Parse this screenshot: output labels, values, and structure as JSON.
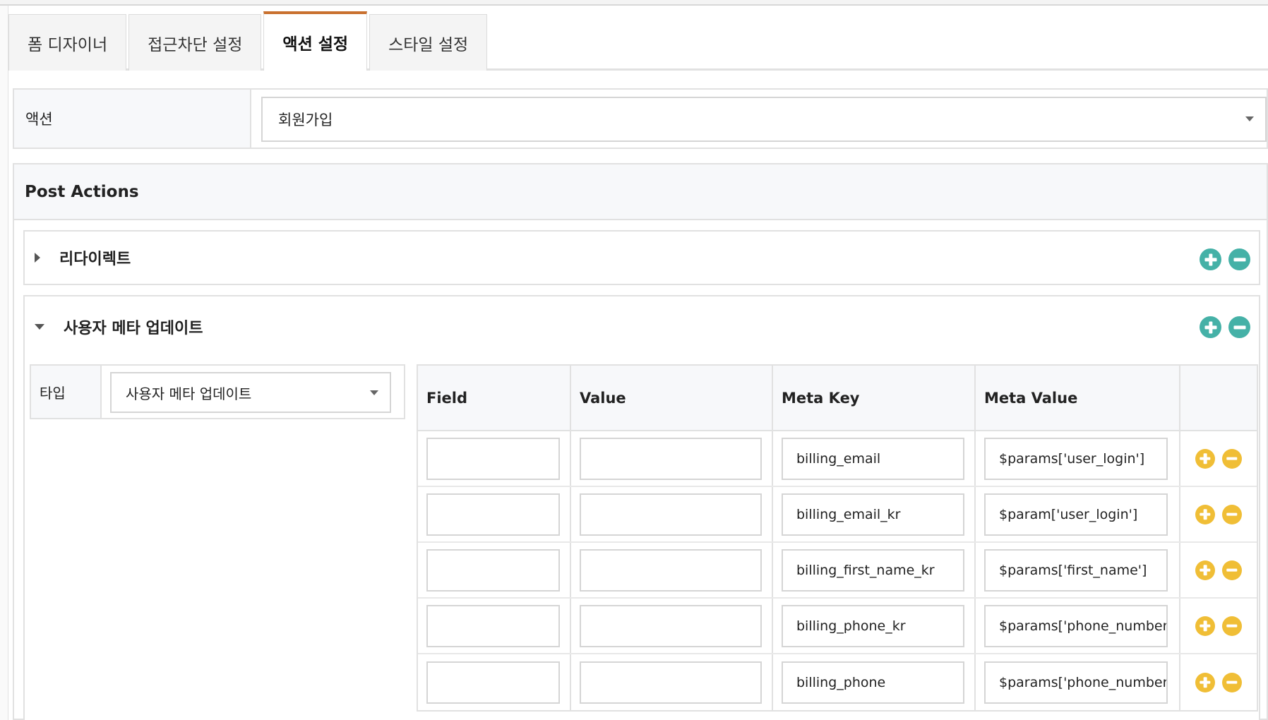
{
  "tabs": [
    {
      "label": "폼 디자이너",
      "active": false
    },
    {
      "label": "접근차단 설정",
      "active": false
    },
    {
      "label": "액션 설정",
      "active": true
    },
    {
      "label": "스타일 설정",
      "active": false
    }
  ],
  "action": {
    "label": "액션",
    "selected": "회원가입"
  },
  "post_actions": {
    "title": "Post Actions",
    "items": [
      {
        "title": "리다이렉트",
        "expanded": false
      },
      {
        "title": "사용자 메타 업데이트",
        "expanded": true
      }
    ]
  },
  "meta_update": {
    "type_label": "타입",
    "type_value": "사용자 메타 업데이트",
    "columns": [
      "Field",
      "Value",
      "Meta Key",
      "Meta Value"
    ],
    "rows": [
      {
        "field": "",
        "value": "",
        "meta_key": "billing_email",
        "meta_value": "$params['user_login']"
      },
      {
        "field": "",
        "value": "",
        "meta_key": "billing_email_kr",
        "meta_value": "$param['user_login']"
      },
      {
        "field": "",
        "value": "",
        "meta_key": "billing_first_name_kr",
        "meta_value": "$params['first_name']"
      },
      {
        "field": "",
        "value": "",
        "meta_key": "billing_phone_kr",
        "meta_value": "$params['phone_number'"
      },
      {
        "field": "",
        "value": "",
        "meta_key": "billing_phone",
        "meta_value": "$params['phone_number'"
      }
    ]
  },
  "colors": {
    "accent_tab": "#c9712f",
    "teal_button": "#45b1a7",
    "yellow_button": "#f0be36"
  },
  "icons": {
    "add": "plus-circle-icon",
    "remove": "minus-circle-icon",
    "expand": "triangle-right-icon",
    "collapse": "triangle-down-icon",
    "dropdown": "caret-down-icon"
  }
}
